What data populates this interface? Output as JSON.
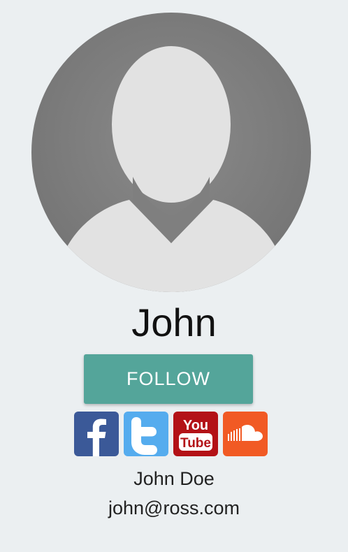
{
  "profile": {
    "display_name": "John",
    "full_name": "John Doe",
    "email": "john@ross.com",
    "avatar_icon": "default-user-silhouette-icon"
  },
  "actions": {
    "follow_label": "FOLLOW"
  },
  "social": {
    "items": [
      {
        "icon": "facebook-icon",
        "color": "#3b5998"
      },
      {
        "icon": "twitter-icon",
        "color": "#55acee"
      },
      {
        "icon": "youtube-icon",
        "color": "#b31217",
        "text_top": "You",
        "text_bottom": "Tube"
      },
      {
        "icon": "soundcloud-icon",
        "color": "#f15a24"
      }
    ]
  },
  "colors": {
    "background": "#ebeff1",
    "accent": "#54a59a",
    "avatar_bg": "#7b7b7b",
    "avatar_fg": "#e2e2e2"
  }
}
